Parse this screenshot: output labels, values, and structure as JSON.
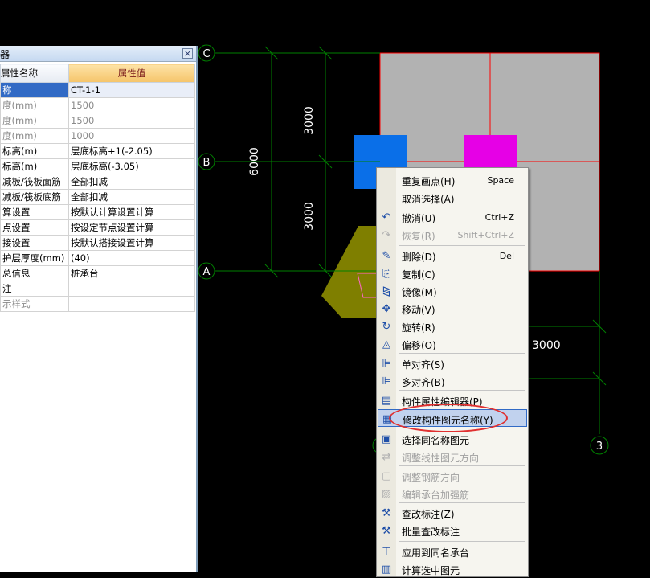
{
  "panel": {
    "title": "器",
    "close_glyph": "×",
    "col_name": "属性名称",
    "col_value": "属性值",
    "rows": [
      {
        "name": "称",
        "value": "CT-1-1",
        "gray": false,
        "sel": true
      },
      {
        "name": "度(mm)",
        "value": "1500",
        "gray": true
      },
      {
        "name": "度(mm)",
        "value": "1500",
        "gray": true
      },
      {
        "name": "度(mm)",
        "value": "1000",
        "gray": true
      },
      {
        "name": "标高(m)",
        "value": "层底标高+1(-2.05)",
        "gray": false
      },
      {
        "name": "标高(m)",
        "value": "层底标高(-3.05)",
        "gray": false
      },
      {
        "name": "减板/筏板面筋",
        "value": "全部扣减",
        "gray": false
      },
      {
        "name": "减板/筏板底筋",
        "value": "全部扣减",
        "gray": false
      },
      {
        "name": "算设置",
        "value": "按默认计算设置计算",
        "gray": false
      },
      {
        "name": "点设置",
        "value": "按设定节点设置计算",
        "gray": false
      },
      {
        "name": "接设置",
        "value": "按默认搭接设置计算",
        "gray": false
      },
      {
        "name": "护层厚度(mm)",
        "value": "(40)",
        "gray": false
      },
      {
        "name": "总信息",
        "value": "桩承台",
        "gray": false
      },
      {
        "name": "注",
        "value": "",
        "gray": false
      },
      {
        "name": "示样式",
        "value": "",
        "gray": true
      }
    ]
  },
  "canvas": {
    "axis_c": "C",
    "axis_b": "B",
    "axis_a": "A",
    "axis_3": "3",
    "dim_3000_top": "3000",
    "dim_6000": "6000",
    "dim_3000_mid": "3000",
    "dim_3000_right": "3000",
    "colors": {
      "bg": "#000000",
      "axis": "#008000",
      "slab": "#b2b2b2",
      "slab_border": "#ff0000",
      "blue_block": "#0a6fe8",
      "magenta_block": "#e600e6",
      "olive": "#7f7f00"
    }
  },
  "menu": {
    "items": [
      {
        "label": "重复画点(H)",
        "shortcut": "Space",
        "icon": "",
        "disabled": false
      },
      {
        "label": "取消选择(A)",
        "shortcut": "",
        "icon": "",
        "disabled": false
      },
      {
        "label": "撤消(U)",
        "shortcut": "Ctrl+Z",
        "icon": "undo-icon",
        "disabled": false
      },
      {
        "label": "恢复(R)",
        "shortcut": "Shift+Ctrl+Z",
        "icon": "redo-icon",
        "disabled": true
      },
      {
        "label": "删除(D)",
        "shortcut": "Del",
        "icon": "delete-icon",
        "disabled": false
      },
      {
        "label": "复制(C)",
        "shortcut": "",
        "icon": "copy-icon",
        "disabled": false
      },
      {
        "label": "镜像(M)",
        "shortcut": "",
        "icon": "mirror-icon",
        "disabled": false
      },
      {
        "label": "移动(V)",
        "shortcut": "",
        "icon": "move-icon",
        "disabled": false
      },
      {
        "label": "旋转(R)",
        "shortcut": "",
        "icon": "rotate-icon",
        "disabled": false
      },
      {
        "label": "偏移(O)",
        "shortcut": "",
        "icon": "offset-icon",
        "disabled": false
      },
      {
        "label": "单对齐(S)",
        "shortcut": "",
        "icon": "align-single-icon",
        "disabled": false
      },
      {
        "label": "多对齐(B)",
        "shortcut": "",
        "icon": "align-multi-icon",
        "disabled": false
      },
      {
        "label": "构件属性编辑器(P)",
        "shortcut": "",
        "icon": "property-editor-icon",
        "disabled": false
      },
      {
        "label": "修改构件图元名称(Y)",
        "shortcut": "",
        "icon": "rename-icon",
        "disabled": false
      },
      {
        "label": "选择同名称图元",
        "shortcut": "",
        "icon": "select-same-icon",
        "disabled": false
      },
      {
        "label": "调整线性图元方向",
        "shortcut": "",
        "icon": "line-direction-icon",
        "disabled": true
      },
      {
        "label": "调整钢筋方向",
        "shortcut": "",
        "icon": "rebar-direction-icon",
        "disabled": true
      },
      {
        "label": "编辑承台加强筋",
        "shortcut": "",
        "icon": "edit-rebar-icon",
        "disabled": true
      },
      {
        "label": "查改标注(Z)",
        "shortcut": "",
        "icon": "edit-label-icon",
        "disabled": false
      },
      {
        "label": "批量查改标注",
        "shortcut": "",
        "icon": "batch-label-icon",
        "disabled": false
      },
      {
        "label": "应用到同名承台",
        "shortcut": "",
        "icon": "apply-same-icon",
        "disabled": false
      },
      {
        "label": "计算选中图元",
        "shortcut": "",
        "icon": "calc-icon",
        "disabled": false
      }
    ]
  }
}
